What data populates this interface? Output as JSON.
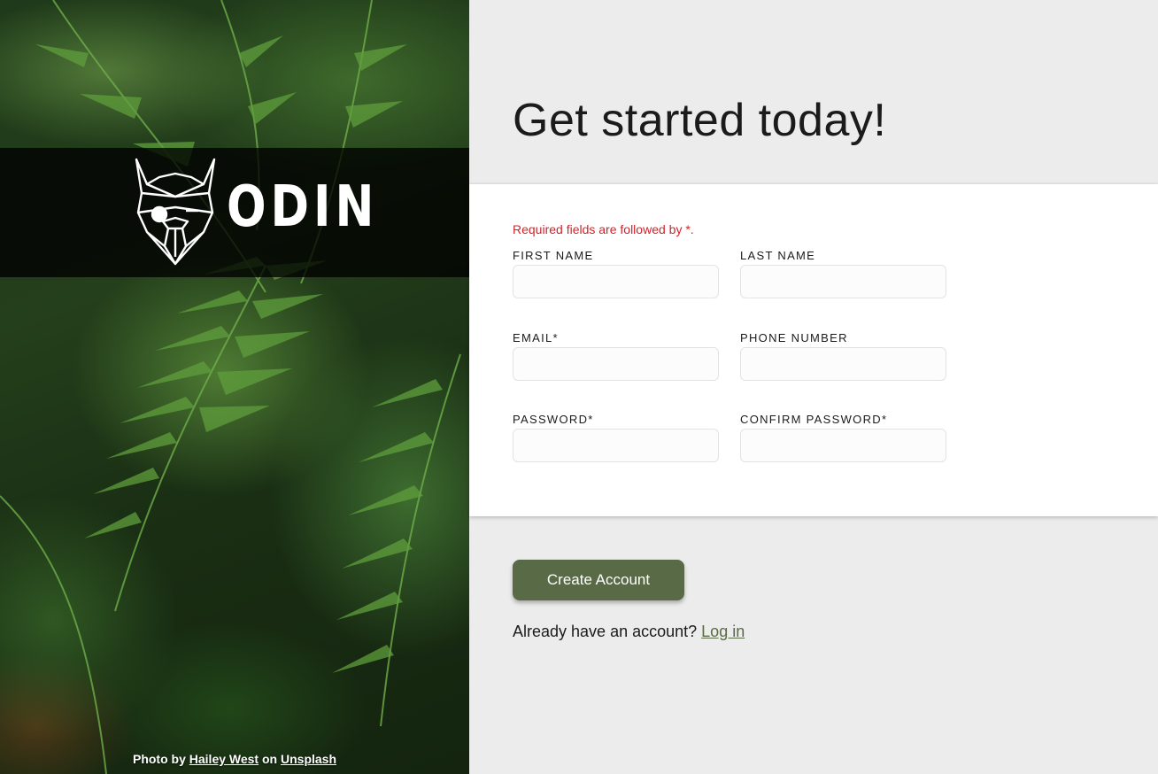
{
  "hero": {
    "logo_text": "ODIN",
    "credit": {
      "prefix": "Photo by",
      "author": "Hailey West",
      "middle": "on",
      "site": "Unsplash"
    }
  },
  "main": {
    "headline": "Get started today!",
    "required_note": "Required fields are followed by *.",
    "fields": {
      "first_name": {
        "label": "FIRST NAME",
        "value": "",
        "placeholder": ""
      },
      "last_name": {
        "label": "LAST NAME",
        "value": "",
        "placeholder": ""
      },
      "email": {
        "label": "EMAIL*",
        "value": "",
        "placeholder": ""
      },
      "phone": {
        "label": "PHONE NUMBER",
        "value": "",
        "placeholder": ""
      },
      "password": {
        "label": "PASSWORD*",
        "value": "",
        "placeholder": ""
      },
      "confirm_password": {
        "label": "CONFIRM PASSWORD*",
        "value": "",
        "placeholder": ""
      }
    },
    "create_button": "Create Account",
    "login_prompt": "Already have an account?",
    "login_link": "Log in"
  },
  "colors": {
    "accent": "#596a46",
    "required": "#d3222a",
    "background": "#ececec",
    "card": "#ffffff",
    "banner": "#000000"
  },
  "icons": [
    "viking-helmet-logo-icon"
  ]
}
